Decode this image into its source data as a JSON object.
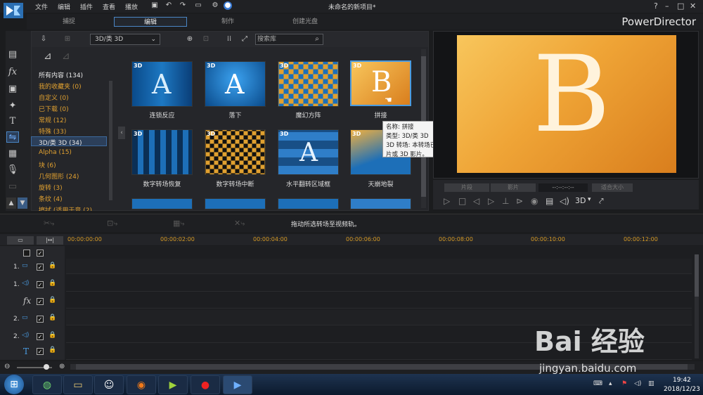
{
  "menu": [
    "文件",
    "编辑",
    "插件",
    "查看",
    "播放"
  ],
  "doc_title": "未命名的新项目*",
  "brand": "PowerDirector",
  "mode_tabs": [
    "捕捉",
    "编辑",
    "制作",
    "创建光盘"
  ],
  "library": {
    "category_select": "3D/类 3D",
    "search_placeholder": "搜索库",
    "categories": [
      "所有内容 (134)",
      "我的收藏夹 (0)",
      "自定义 (0)",
      "已下载 (0)",
      "常规 (12)",
      "特殊 (33)",
      "3D/类 3D (34)",
      "Alpha (15)",
      "块 (6)",
      "几何图形 (24)",
      "旋转 (3)",
      "条纹 (4)",
      "擦拭 (适用于音 (2)"
    ],
    "transitions": [
      {
        "name": "连锁反应",
        "tag": "3D"
      },
      {
        "name": "落下",
        "tag": "3D"
      },
      {
        "name": "魔幻方阵",
        "tag": "3D"
      },
      {
        "name": "拼接",
        "tag": "3D"
      },
      {
        "name": "数字转场恢复",
        "tag": "3D"
      },
      {
        "name": "数字转场中断",
        "tag": "3D"
      },
      {
        "name": "水平翻转区域框",
        "tag": "3D"
      },
      {
        "name": "天崩地裂",
        "tag": "3D"
      }
    ],
    "tooltip": {
      "name": "名称: 拼接",
      "type": "类型: 3D/类 3D",
      "desc": "3D 转场: 本转场已 3D 就绪。使用该转场时，可以将视频输出为标准 2D 影片或 3D 影片。"
    }
  },
  "preview": {
    "clip_btn": "片段",
    "movie_btn": "影片",
    "timecode": "--:--:--:--",
    "size": "适合大小",
    "mode3d": "3D"
  },
  "hint": "拖动所选转场至视频轨。",
  "timeline": {
    "ticks": [
      "00:00:00:00",
      "00:00:02:00",
      "00:00:04:00",
      "00:00:06:00",
      "00:00:08:00",
      "00:00:10:00",
      "00:00:12:00"
    ],
    "tracks": [
      {
        "label": "1."
      },
      {
        "label": "1."
      },
      {
        "label": "fx"
      },
      {
        "label": "2."
      },
      {
        "label": "2."
      },
      {
        "label": "T"
      }
    ]
  },
  "taskbar": {
    "time": "19:42",
    "date": "2018/12/23"
  },
  "watermark": {
    "text": "Bai 经验",
    "url": "jingyan.baidu.com"
  },
  "colors": {
    "accent": "#4a86c5",
    "category": "#e0a030",
    "timecode": "#d59a26"
  }
}
